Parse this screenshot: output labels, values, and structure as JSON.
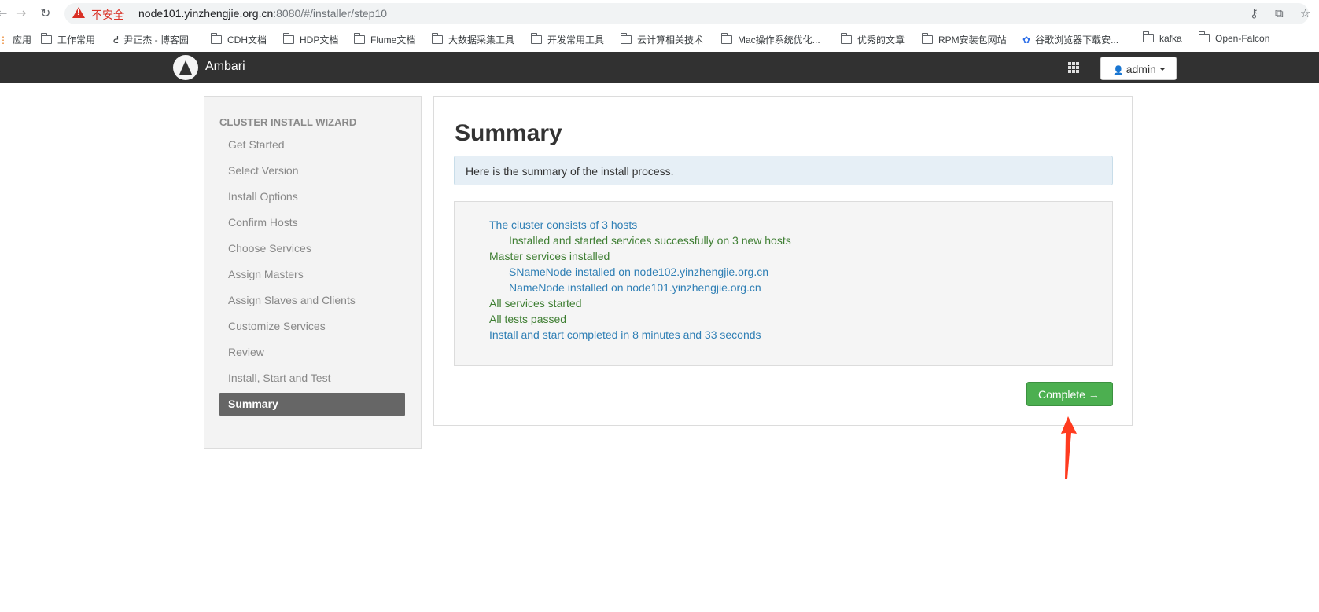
{
  "browser": {
    "security_label": "不安全",
    "url_host": "node101.yinzhengjie.org.cn",
    "url_rest": ":8080/#/installer/step10",
    "bookmarks": [
      {
        "label": "应用",
        "icon": "apps-icon"
      },
      {
        "label": "工作常用",
        "icon": "folder-icon"
      },
      {
        "label": "尹正杰 - 博客园",
        "icon": "blog-icon"
      },
      {
        "label": "CDH文档",
        "icon": "folder-icon"
      },
      {
        "label": "HDP文档",
        "icon": "folder-icon"
      },
      {
        "label": "Flume文档",
        "icon": "folder-icon"
      },
      {
        "label": "大数据采集工具",
        "icon": "folder-icon"
      },
      {
        "label": "开发常用工具",
        "icon": "folder-icon"
      },
      {
        "label": "云计算相关技术",
        "icon": "folder-icon"
      },
      {
        "label": "Mac操作系统优化...",
        "icon": "folder-icon"
      },
      {
        "label": "优秀的文章",
        "icon": "folder-icon"
      },
      {
        "label": "RPM安装包网站",
        "icon": "folder-icon"
      },
      {
        "label": "谷歌浏览器下载安...",
        "icon": "baidu-icon"
      },
      {
        "label": "kafka",
        "icon": "folder-icon"
      },
      {
        "label": "Open-Falcon",
        "icon": "folder-icon"
      }
    ]
  },
  "navbar": {
    "brand": "Ambari",
    "user_label": "admin"
  },
  "sidebar": {
    "title": "CLUSTER INSTALL WIZARD",
    "items": [
      {
        "label": "Get Started"
      },
      {
        "label": "Select Version"
      },
      {
        "label": "Install Options"
      },
      {
        "label": "Confirm Hosts"
      },
      {
        "label": "Choose Services"
      },
      {
        "label": "Assign Masters"
      },
      {
        "label": "Assign Slaves and Clients"
      },
      {
        "label": "Customize Services"
      },
      {
        "label": "Review"
      },
      {
        "label": "Install, Start and Test"
      },
      {
        "label": "Summary",
        "active": true
      }
    ]
  },
  "main": {
    "title": "Summary",
    "info": "Here is the summary of the install process.",
    "lines": [
      {
        "text": "The cluster consists of 3 hosts",
        "color": "#2f7fb5"
      },
      {
        "text": "Installed and started services successfully on 3 new hosts",
        "color": "#3e7e32"
      },
      {
        "text": "Master services installed",
        "color": "#3e7e32"
      },
      {
        "text": "SNameNode installed on node102.yinzhengjie.org.cn",
        "color": "#2f7fb5"
      },
      {
        "text": "NameNode installed on node101.yinzhengjie.org.cn",
        "color": "#2f7fb5"
      },
      {
        "text": "All services started",
        "color": "#3e7e32"
      },
      {
        "text": "All tests passed",
        "color": "#3e7e32"
      },
      {
        "text": "Install and start completed in 8 minutes and 33 seconds",
        "color": "#2f7fb5"
      }
    ],
    "complete_button": "Complete →"
  },
  "colors": {
    "navbar": "#313131",
    "active_item": "#666666",
    "success_button": "#4caf50",
    "annotation_arrow": "#ff3b1f"
  }
}
